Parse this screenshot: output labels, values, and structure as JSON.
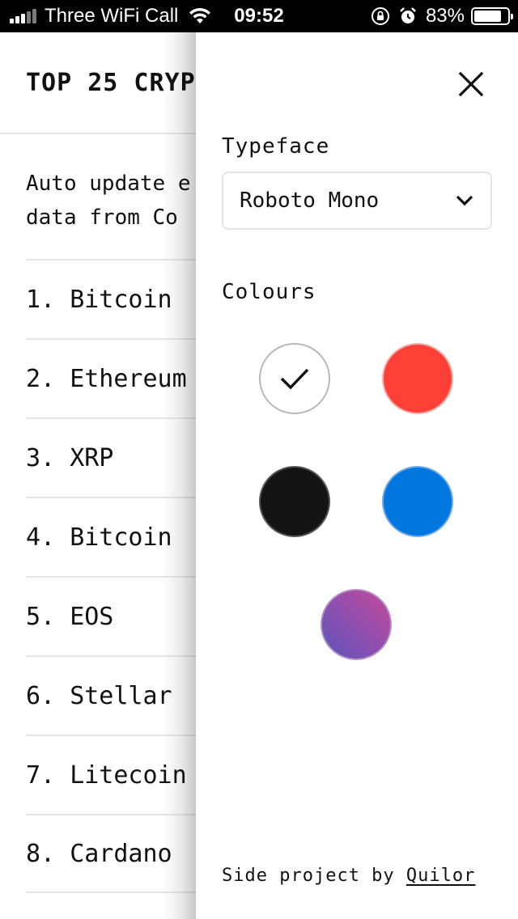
{
  "status_bar": {
    "carrier": "Three WiFi Call",
    "time": "09:52",
    "battery_percent": "83%",
    "battery_level": 0.83,
    "icons": [
      "signal-icon",
      "wifi-icon",
      "orientation-lock-icon",
      "alarm-icon",
      "battery-icon"
    ]
  },
  "main": {
    "title": "TOP 25 CRYP",
    "description": "Auto update e\ndata from Co",
    "coins": [
      {
        "rank": "1.",
        "name": "Bitcoin"
      },
      {
        "rank": "2.",
        "name": "Ethereum"
      },
      {
        "rank": "3.",
        "name": "XRP"
      },
      {
        "rank": "4.",
        "name": "Bitcoin"
      },
      {
        "rank": "5.",
        "name": "EOS"
      },
      {
        "rank": "6.",
        "name": "Stellar"
      },
      {
        "rank": "7.",
        "name": "Litecoin"
      },
      {
        "rank": "8.",
        "name": "Cardano"
      }
    ]
  },
  "settings": {
    "typeface_label": "Typeface",
    "typeface_value": "Roboto Mono",
    "colours_label": "Colours",
    "colours": [
      {
        "name": "white",
        "hex": "#ffffff",
        "selected": true
      },
      {
        "name": "red",
        "hex": "#ff4036",
        "selected": false
      },
      {
        "name": "black",
        "hex": "#141414",
        "selected": false
      },
      {
        "name": "blue",
        "hex": "#0076df",
        "selected": false
      },
      {
        "name": "purple-gradient",
        "hex": "#8b4fb0",
        "selected": false
      }
    ],
    "credit_prefix": "Side project by ",
    "credit_link": "Quilor"
  }
}
